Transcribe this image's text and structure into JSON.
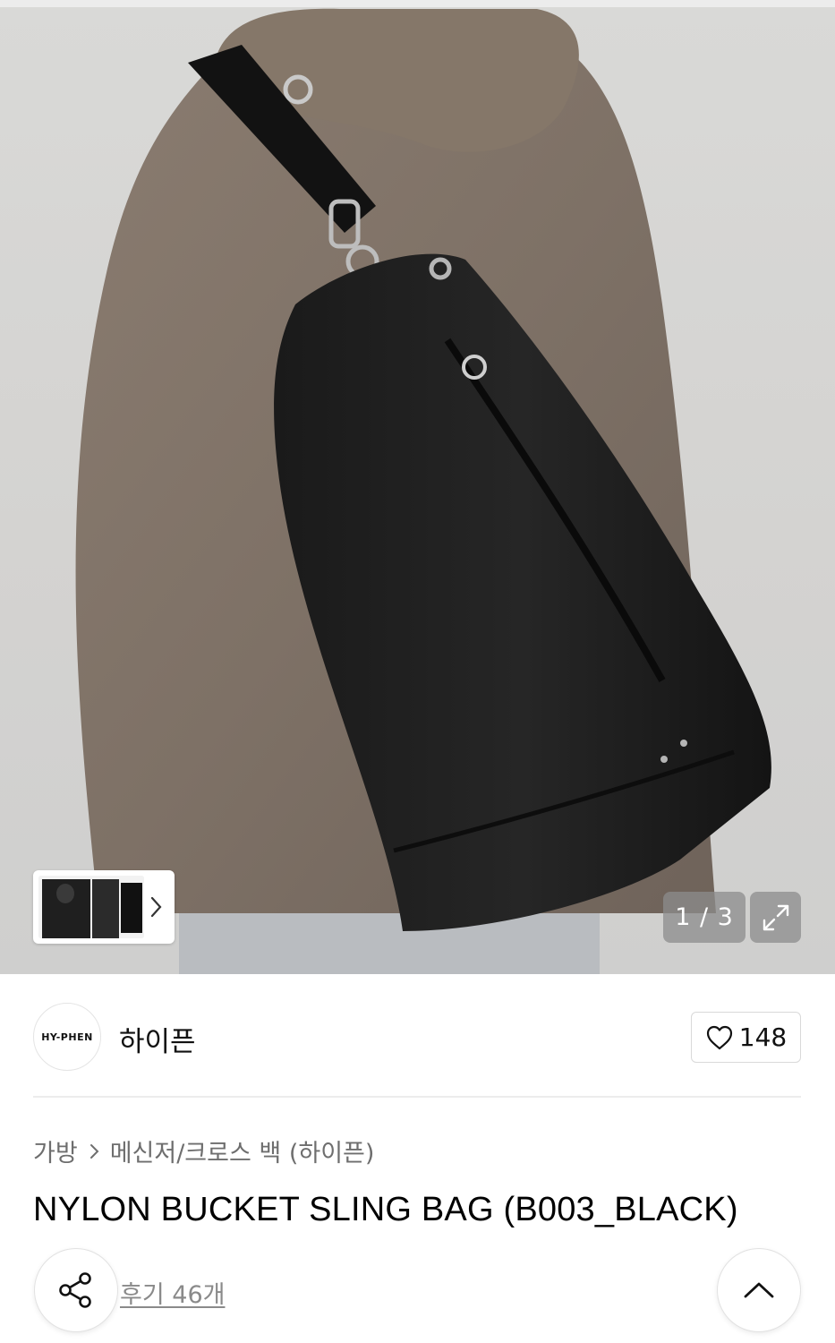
{
  "gallery": {
    "counter_text": "1 / 3",
    "current_index": 1,
    "total_images": 3,
    "expand_icon": "expand-icon",
    "thumb_arrow_icon": "chevron-right-icon"
  },
  "brand": {
    "logo_text": "HY-PHEN",
    "name": "하이픈",
    "like_icon": "heart-outline-icon",
    "like_count": "148"
  },
  "breadcrumb": {
    "items": [
      "가방",
      "메신저/크로스 백 (하이픈)"
    ],
    "separator_icon": "chevron-right-icon"
  },
  "product": {
    "title": "NYLON BUCKET SLING BAG (B003_BLACK)"
  },
  "actions": {
    "share_icon": "share-icon",
    "reviews_label": "후기 46개",
    "scroll_top_icon": "chevron-up-icon"
  },
  "colors": {
    "text_primary": "#111111",
    "text_secondary": "#6e6e6e",
    "link_gray": "#8a8a8a",
    "border": "#d9d9d9",
    "overlay_gray": "#8c8c8c"
  }
}
